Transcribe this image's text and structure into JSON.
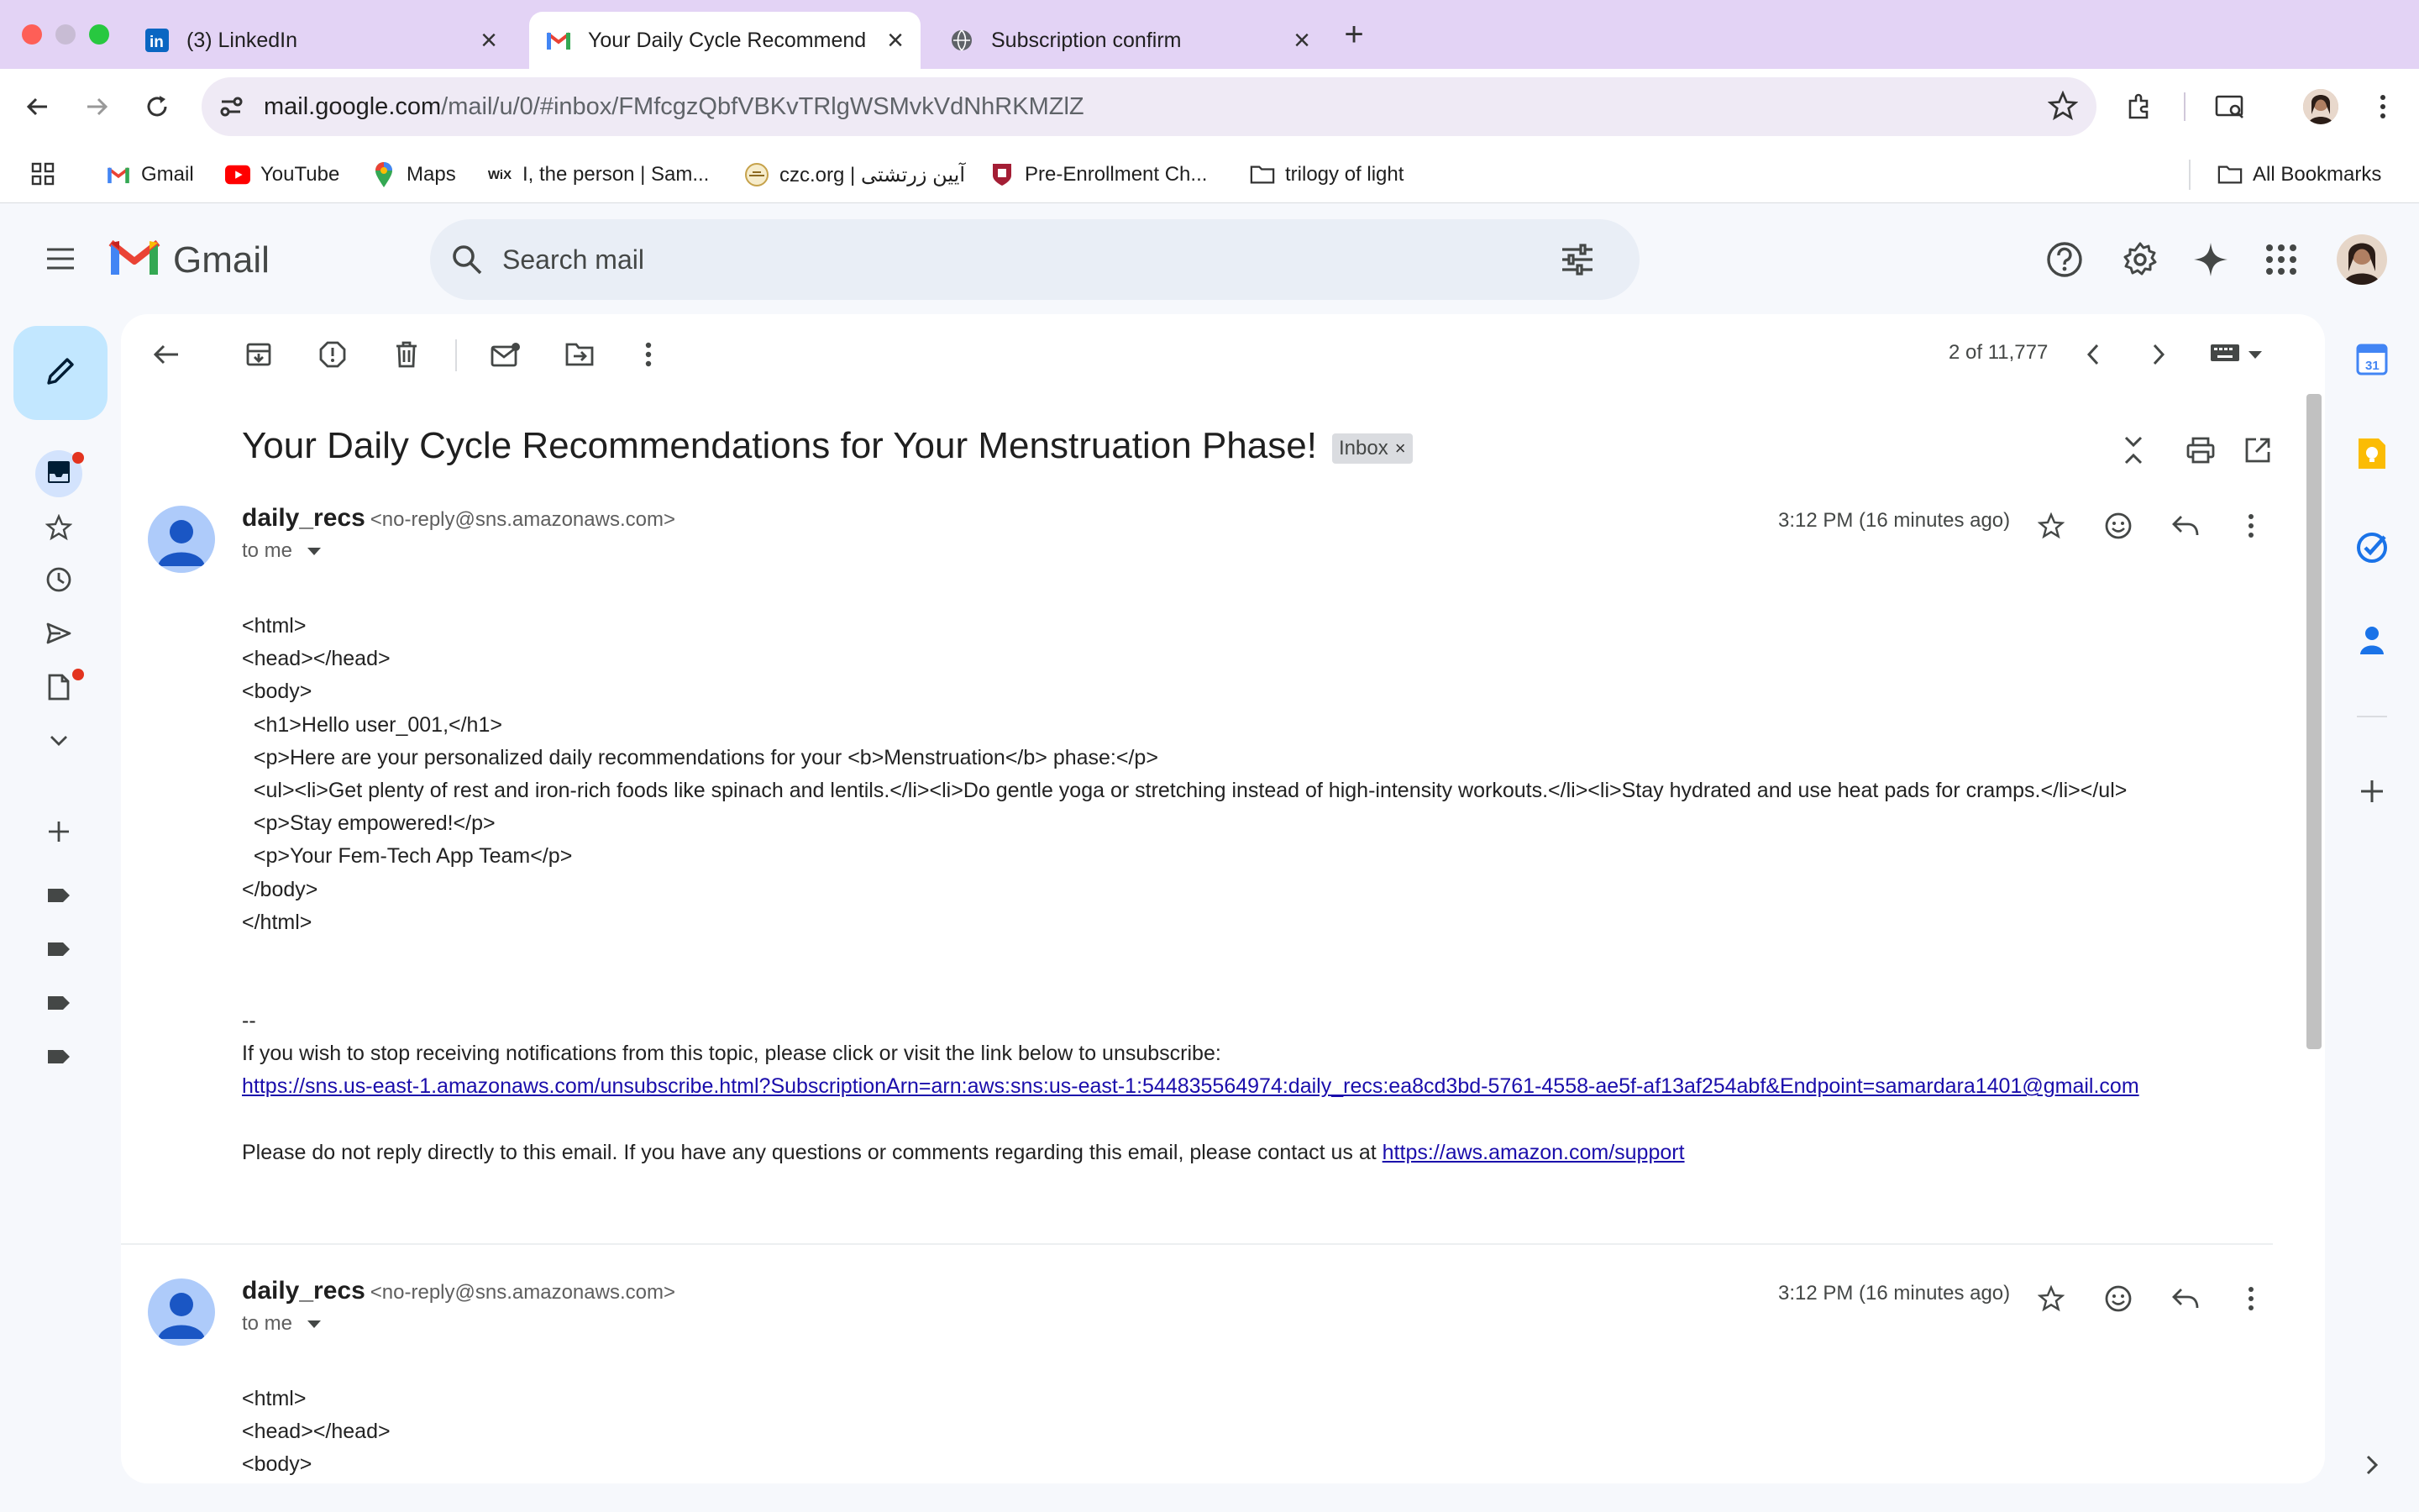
{
  "browser": {
    "tabs": [
      {
        "title": "(3) LinkedIn",
        "icon": "linkedin-icon",
        "active": false
      },
      {
        "title": "Your Daily Cycle Recommend",
        "icon": "gmail-icon",
        "active": true
      },
      {
        "title": "Subscription confirm",
        "icon": "globe-icon",
        "active": false
      }
    ],
    "url_host": "mail.google.com",
    "url_path": "/mail/u/0/#inbox/FMfcgzQbfVBKvTRlgWSMvkVdNhRKMZlZ",
    "bookmarks": [
      {
        "label": "Gmail",
        "icon": "gmail-icon"
      },
      {
        "label": "YouTube",
        "icon": "youtube-icon"
      },
      {
        "label": "Maps",
        "icon": "maps-icon"
      },
      {
        "label": "I, the person | Sam...",
        "icon": "wix-icon"
      },
      {
        "label": "czc.org | آیین زرتشتی",
        "icon": "czc-icon"
      },
      {
        "label": "Pre-Enrollment Ch...",
        "icon": "shield-icon"
      },
      {
        "label": "trilogy of light",
        "icon": "folder-icon"
      }
    ],
    "all_bookmarks": "All Bookmarks"
  },
  "gmail": {
    "logo_text": "Gmail",
    "search_placeholder": "Search mail",
    "pager": "2 of 11,777",
    "subject": "Your Daily Cycle Recommendations for Your Menstruation Phase!",
    "label": "Inbox"
  },
  "messages": [
    {
      "sender": "daily_recs",
      "email": "<no-reply@sns.amazonaws.com>",
      "to": "to me",
      "time": "3:12 PM (16 minutes ago)",
      "body_lines": [
        "<html>",
        "<head></head>",
        "<body>",
        "  <h1>Hello user_001,</h1>",
        "  <p>Here are your personalized daily recommendations for your <b>Menstruation</b> phase:</p>",
        "  <ul><li>Get plenty of rest and iron-rich foods like spinach and lentils.</li><li>Do gentle yoga or stretching instead of high-intensity workouts.</li><li>Stay hydrated and use heat pads for cramps.</li></ul>",
        "  <p>Stay empowered!</p>",
        "  <p>Your Fem-Tech App Team</p>",
        "</body>",
        "</html>"
      ],
      "signature_sep": "--",
      "unsubscribe_text": "If you wish to stop receiving notifications from this topic, please click or visit the link below to unsubscribe:",
      "unsubscribe_link": "https://sns.us-east-1.amazonaws.com/unsubscribe.html?SubscriptionArn=arn:aws:sns:us-east-1:544835564974:daily_recs:ea8cd3bd-5761-4558-ae5f-af13af254abf&Endpoint=samardara1401@gmail.com",
      "support_text": "Please do not reply directly to this email. If you have any questions or comments regarding this email, please contact us at ",
      "support_link": "https://aws.amazon.com/support"
    },
    {
      "sender": "daily_recs",
      "email": "<no-reply@sns.amazonaws.com>",
      "to": "to me",
      "time": "3:12 PM (16 minutes ago)",
      "body_lines": [
        "<html>",
        "<head></head>",
        "<body>"
      ]
    }
  ]
}
